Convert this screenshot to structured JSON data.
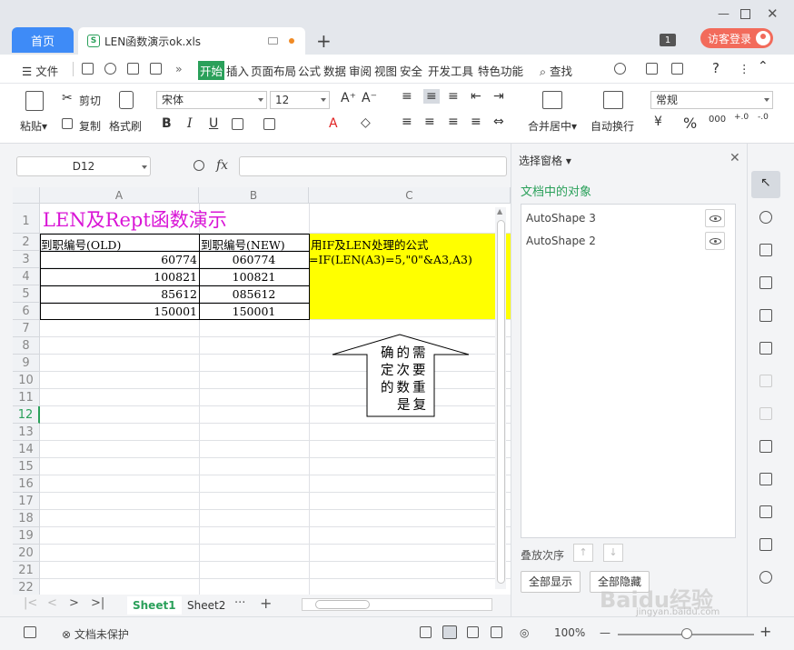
{
  "tabs": {
    "home": "首页",
    "document": "LEN函数演示ok.xls"
  },
  "title_bar": {
    "badge": "1",
    "login": "访客登录"
  },
  "menu": {
    "file": "文件",
    "items": [
      "开始",
      "插入",
      "页面布局",
      "公式",
      "数据",
      "审阅",
      "视图",
      "安全",
      "开发工具",
      "特色功能"
    ],
    "search": "查找"
  },
  "ribbon": {
    "paste": "粘贴",
    "cut": "剪切",
    "copy": "复制",
    "format_painter": "格式刷",
    "font_name": "宋体",
    "font_size": "12",
    "increase_font": "A⁺",
    "decrease_font": "A⁻",
    "merge_center": "合并居中",
    "wrap_text": "自动换行",
    "number_format": "常规",
    "bold": "B",
    "italic": "I",
    "underline": "U"
  },
  "formula_bar": {
    "cell_ref": "D12",
    "fx": "fx",
    "formula": ""
  },
  "grid": {
    "columns": [
      "A",
      "B",
      "C"
    ],
    "rows": [
      "1",
      "2",
      "3",
      "4",
      "5",
      "6",
      "7",
      "8",
      "9",
      "10",
      "11",
      "12",
      "13",
      "14",
      "15",
      "16",
      "17",
      "18",
      "19",
      "20",
      "21",
      "22"
    ],
    "selected_row": "12",
    "title": "LEN及Rept函数演示",
    "header_a": "到职编号(OLD)",
    "header_b": "到职编号(NEW)",
    "header_c": "用IF及LEN处理的公式",
    "formula_c3": "=IF(LEN(A3)=5,\"0\"&A3,A3)",
    "data": [
      {
        "old": "60774",
        "new": "060774"
      },
      {
        "old": "100821",
        "new": "100821"
      },
      {
        "old": "85612",
        "new": "085612"
      },
      {
        "old": "150001",
        "new": "150001"
      }
    ],
    "callout_lines": [
      "确的需",
      "定次要",
      "的数重",
      "是复"
    ]
  },
  "sheets": {
    "tabs": [
      "Sheet1",
      "Sheet2"
    ],
    "more": "···",
    "add": "+"
  },
  "status": {
    "protect": "文档未保护",
    "zoom": "100%"
  },
  "selection_pane": {
    "title": "选择窗格",
    "subtitle": "文档中的对象",
    "objects": [
      "AutoShape 3",
      "AutoShape 2"
    ],
    "order_label": "叠放次序",
    "show_all": "全部显示",
    "hide_all": "全部隐藏"
  },
  "watermark": {
    "text": "Baidu经验",
    "sub": "jingyan.baidu.com"
  }
}
